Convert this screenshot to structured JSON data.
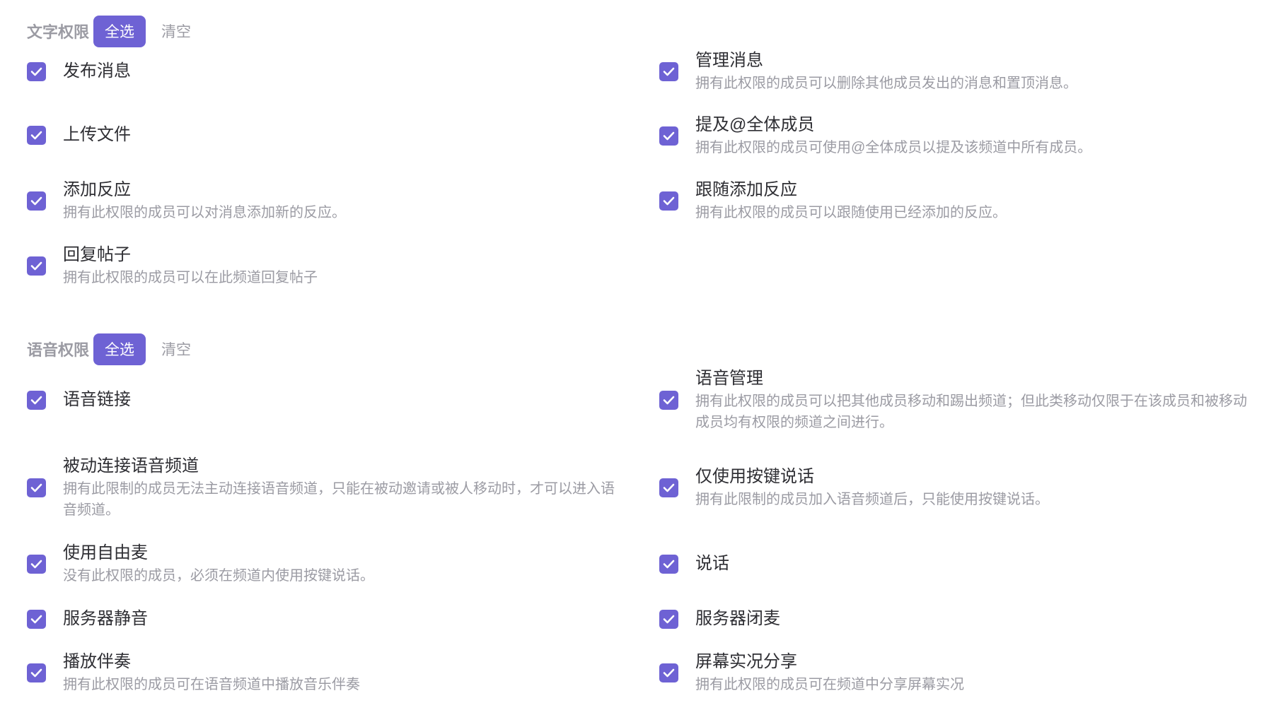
{
  "sections": [
    {
      "title": "文字权限",
      "select_all": "全选",
      "clear": "清空",
      "left": [
        {
          "label": "发布消息",
          "desc": ""
        },
        {
          "label": "上传文件",
          "desc": ""
        },
        {
          "label": "添加反应",
          "desc": "拥有此权限的成员可以对消息添加新的反应。"
        },
        {
          "label": "回复帖子",
          "desc": "拥有此权限的成员可以在此频道回复帖子"
        }
      ],
      "right": [
        {
          "label": "管理消息",
          "desc": "拥有此权限的成员可以删除其他成员发出的消息和置顶消息。"
        },
        {
          "label": "提及@全体成员",
          "desc": "拥有此权限的成员可使用@全体成员以提及该频道中所有成员。"
        },
        {
          "label": "跟随添加反应",
          "desc": "拥有此权限的成员可以跟随使用已经添加的反应。"
        }
      ]
    },
    {
      "title": "语音权限",
      "select_all": "全选",
      "clear": "清空",
      "left": [
        {
          "label": "语音链接",
          "desc": ""
        },
        {
          "label": "被动连接语音频道",
          "desc": "拥有此限制的成员无法主动连接语音频道，只能在被动邀请或被人移动时，才可以进入语",
          "desc2": "音频道。"
        },
        {
          "label": "使用自由麦",
          "desc": "没有此权限的成员，必须在频道内使用按键说话。"
        },
        {
          "label": "服务器静音",
          "desc": ""
        },
        {
          "label": "播放伴奏",
          "desc": "拥有此权限的成员可在语音频道中播放音乐伴奏"
        }
      ],
      "right": [
        {
          "label": "语音管理",
          "desc": "拥有此权限的成员可以把其他成员移动和踢出频道；但此类移动仅限于在该成员和被移动",
          "desc2": "成员均有权限的频道之间进行。"
        },
        {
          "label": "仅使用按键说话",
          "desc": "拥有此限制的成员加入语音频道后，只能使用按键说话。"
        },
        {
          "label": "说话",
          "desc": ""
        },
        {
          "label": "服务器闭麦",
          "desc": ""
        },
        {
          "label": "屏幕实况分享",
          "desc": "拥有此权限的成员可在频道中分享屏幕实况"
        }
      ]
    }
  ],
  "checked_all": true,
  "colors": {
    "accent": "#6e62d4",
    "title_gray": "#9b9ba3",
    "text": "#2e2e33"
  },
  "icons": {
    "checkbox": "check-icon"
  }
}
